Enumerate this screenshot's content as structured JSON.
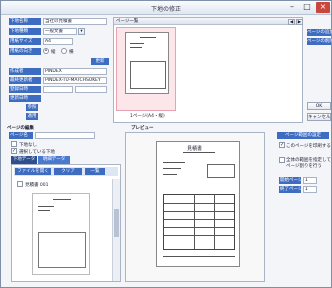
{
  "window": {
    "title": "下地の修正"
  },
  "form": {
    "fields": [
      {
        "label": "下地名称",
        "value": "当社の見積書"
      },
      {
        "label": "下地種類",
        "value": "一般文書"
      },
      {
        "label": "用紙サイズ",
        "value": "A4"
      },
      {
        "label": "用紙の向き",
        "value": "縦"
      },
      {
        "label": "作成者",
        "value": "PINDEX"
      },
      {
        "label": "最終更新者",
        "value": "PINDEX-TU-MATCHSUKEY"
      },
      {
        "label": "登録日時",
        "value": ""
      },
      {
        "label": "更新日時",
        "value": ""
      }
    ],
    "orientation_options": [
      "縦",
      "横"
    ],
    "update_button": "更新",
    "side_buttons": [
      "参照",
      "適用"
    ]
  },
  "thumbs": {
    "header": "ページ一覧",
    "caption": "1ページ(A4・縦)",
    "nav": [
      "◀",
      "▶"
    ]
  },
  "right_buttons": [
    "ページの追加",
    "ページの削除",
    "OK",
    "キャンセル"
  ],
  "page_edit": {
    "header": "ページの編集",
    "name_label": "ページ名",
    "name_value": "",
    "options": [
      "下地なし",
      "選択している下地"
    ],
    "tabs": [
      "下地データ",
      "明細データ"
    ],
    "toolbar": [
      "ファイルを開く",
      "クリア",
      "一覧"
    ],
    "list_items": [
      "見積書 001"
    ]
  },
  "preview": {
    "header": "プレビュー",
    "doc_title": "見積書"
  },
  "range": {
    "header": "ページ範囲の設定",
    "options": [
      "このページを印刷する",
      "全体の範囲を指定してページ割りを行う"
    ],
    "fields": [
      {
        "label": "開始ページ",
        "value": "1"
      },
      {
        "label": "終了ページ",
        "value": "1"
      }
    ]
  }
}
